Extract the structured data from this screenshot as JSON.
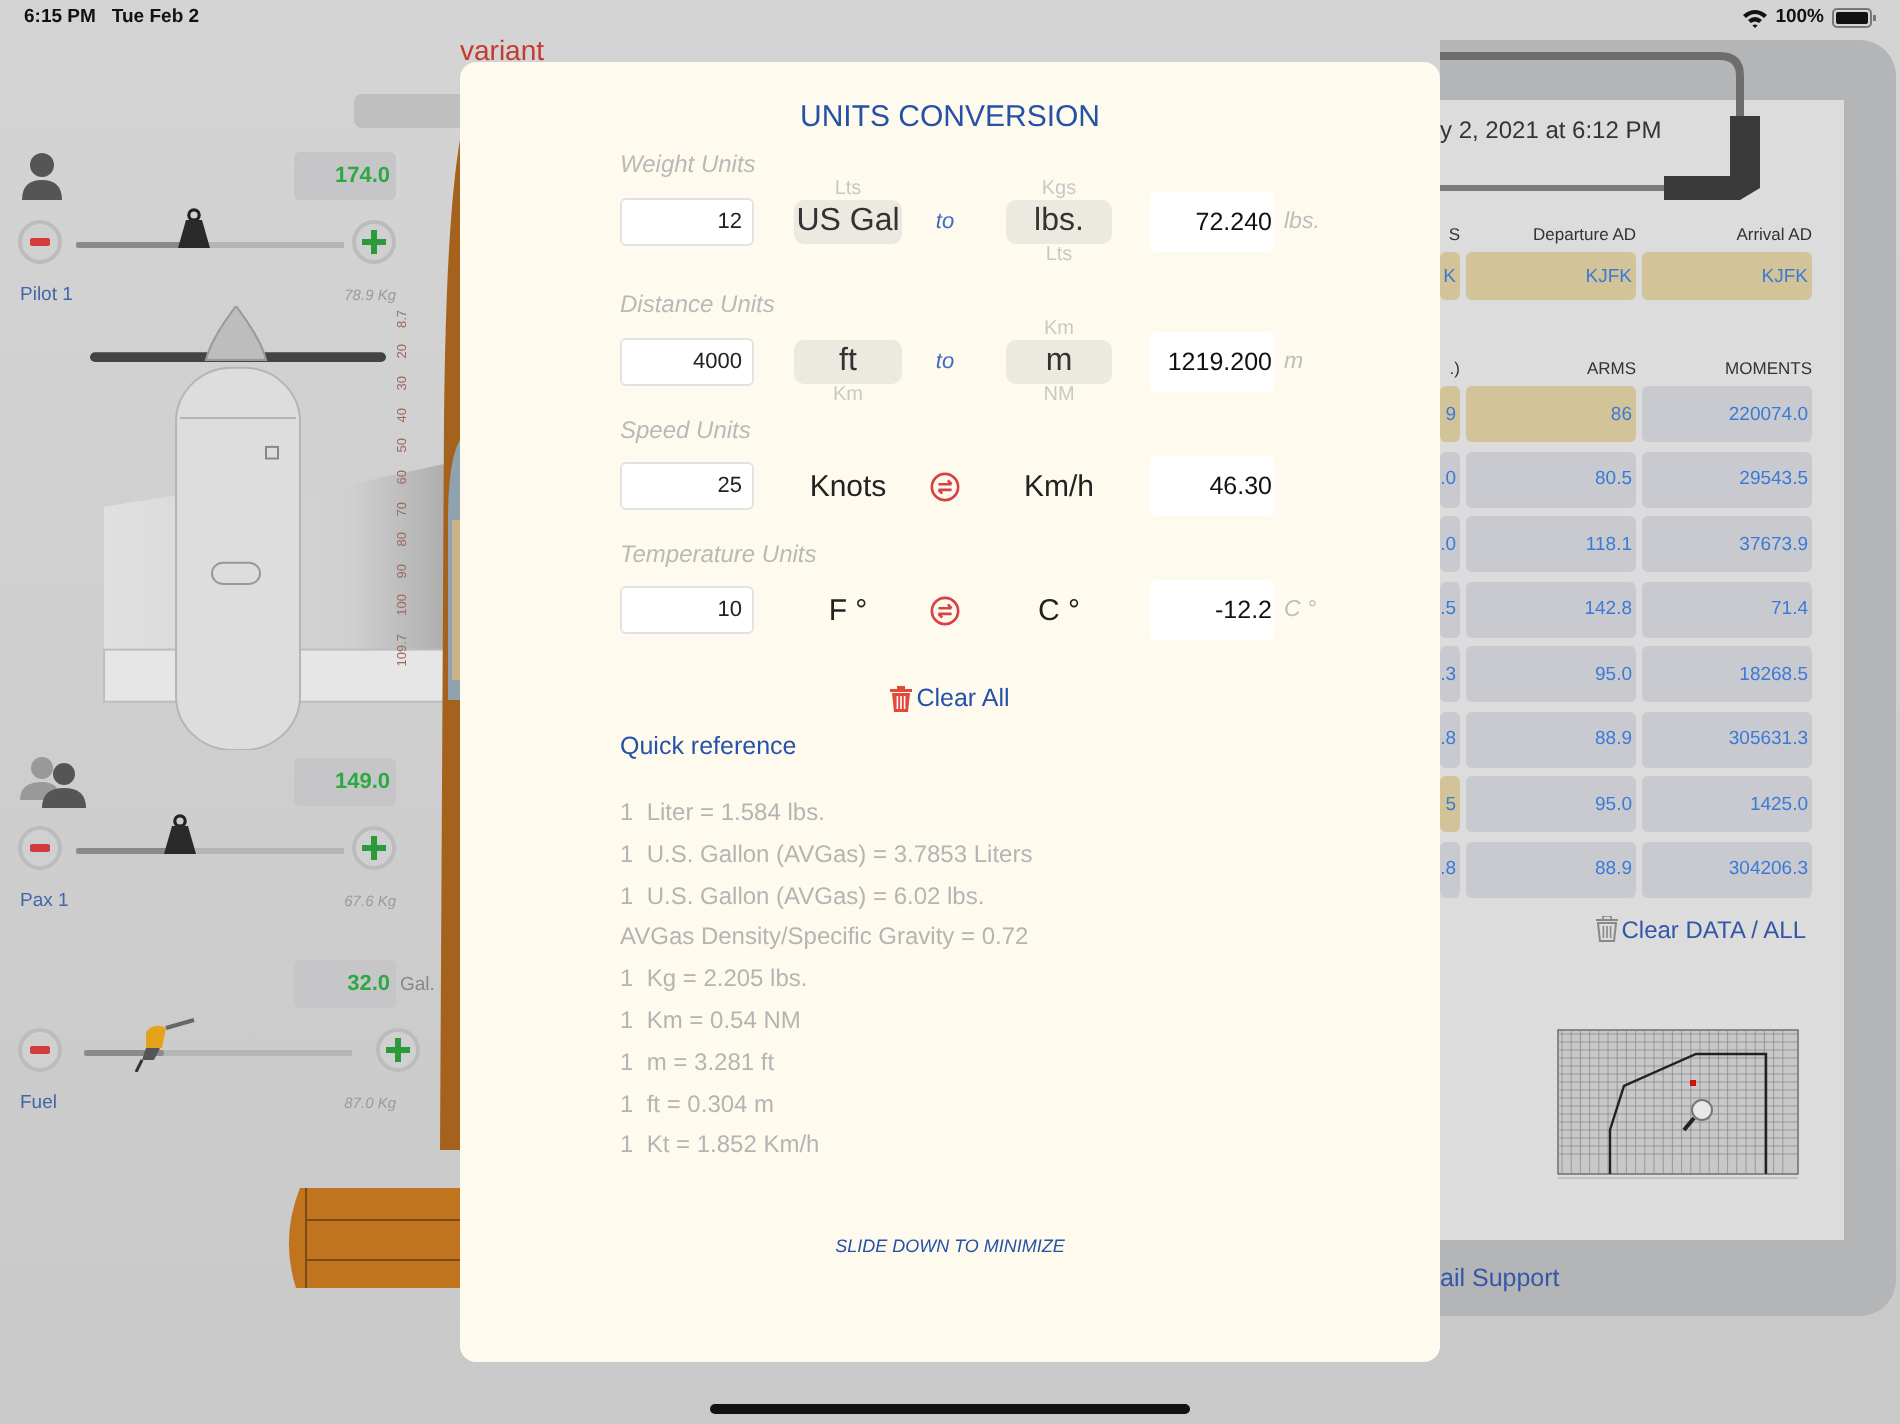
{
  "status_bar": {
    "time": "6:15 PM",
    "date": "Tue Feb 2",
    "battery": "100%"
  },
  "background_title": "variant",
  "loads": [
    {
      "kind": "pilot",
      "label": "Pilot 1",
      "value": "174.0",
      "level": 0.44,
      "mass": "78.9 Kg"
    },
    {
      "kind": "pax",
      "label": "Pax 1",
      "value": "149.0",
      "level": 0.39,
      "mass": "67.6 Kg"
    },
    {
      "kind": "fuel",
      "label": "Fuel",
      "value": "32.0",
      "unit": "Gal.",
      "level": 0.3,
      "mass": "87.0 Kg"
    }
  ],
  "arm_scale": [
    "8.7",
    "20",
    "30",
    "40",
    "50",
    "60",
    "70",
    "80",
    "90",
    "100",
    "109.7"
  ],
  "dialog": {
    "title": "UNITS CONVERSION",
    "sections": [
      {
        "kind": "picker",
        "label": "Weight Units",
        "input": "12",
        "from": {
          "above": "Lts",
          "selected": "US Gal"
        },
        "connector": "to",
        "to": {
          "above": "Kgs",
          "selected": "lbs.",
          "below": "Lts"
        },
        "result": "72.240",
        "unit": "lbs."
      },
      {
        "kind": "picker",
        "label": "Distance Units",
        "input": "4000",
        "from": {
          "selected": "ft",
          "below": "Km"
        },
        "connector": "to",
        "to": {
          "above": "Km",
          "selected": "m",
          "below": "NM"
        },
        "result": "1219.200",
        "unit": "m"
      },
      {
        "kind": "swap",
        "label": "Speed Units",
        "input": "25",
        "from": {
          "selected": "Knots"
        },
        "to": {
          "selected": "Km/h"
        },
        "result": "46.30"
      },
      {
        "kind": "swap",
        "label": "Temperature Units",
        "input": "10",
        "from": {
          "selected": "F °"
        },
        "to": {
          "selected": "C °"
        },
        "result": "-12.2",
        "unit": "C °"
      }
    ],
    "clear_button": "Clear All",
    "reference_title": "Quick reference",
    "reference": [
      "1  Liter = 1.584 lbs.",
      "1  U.S. Gallon (AVGas) = 3.7853 Liters",
      "1  U.S. Gallon (AVGas) = 6.02 lbs.",
      "AVGas Density/Specific Gravity = 0.72",
      "1  Kg = 2.205 lbs.",
      "1  Km = 0.54 NM",
      "1  m = 3.281 ft",
      "1  ft = 0.304 m",
      "1  Kt = 1.852 Km/h"
    ],
    "footer": "SLIDE DOWN TO MINIMIZE"
  },
  "flight_sheet": {
    "date": "y 2, 2021 at 6:12 PM",
    "route_headers": [
      "S",
      "Departure AD",
      "Arrival AD"
    ],
    "route_values": [
      {
        "text": "K",
        "highlighted": true
      },
      {
        "text": "KJFK",
        "highlighted": true
      },
      {
        "text": "KJFK",
        "highlighted": true
      }
    ],
    "table_headers": [
      ".)",
      "ARMS",
      "MOMENTS"
    ],
    "rows": [
      {
        "cells": [
          {
            "text": "9",
            "highlighted": true
          },
          {
            "text": "86",
            "highlighted": true
          },
          {
            "text": "220074.0",
            "highlighted": false
          }
        ]
      },
      {
        "cells": [
          {
            "text": ".0",
            "highlighted": false
          },
          {
            "text": "80.5",
            "highlighted": false
          },
          {
            "text": "29543.5",
            "highlighted": false
          }
        ]
      },
      {
        "cells": [
          {
            "text": ".0",
            "highlighted": false
          },
          {
            "text": "118.1",
            "highlighted": false
          },
          {
            "text": "37673.9",
            "highlighted": false
          }
        ]
      },
      {
        "cells": [
          {
            "text": ".5",
            "highlighted": false
          },
          {
            "text": "142.8",
            "highlighted": false
          },
          {
            "text": "71.4",
            "highlighted": false
          }
        ]
      },
      {
        "cells": [
          {
            "text": ".3",
            "highlighted": false
          },
          {
            "text": "95.0",
            "highlighted": false
          },
          {
            "text": "18268.5",
            "highlighted": false
          }
        ]
      },
      {
        "cells": [
          {
            "text": ".8",
            "highlighted": false
          },
          {
            "text": "88.9",
            "highlighted": false
          },
          {
            "text": "305631.3",
            "highlighted": false
          }
        ]
      },
      {
        "cells": [
          {
            "text": "5",
            "highlighted": true
          },
          {
            "text": "95.0",
            "highlighted": false
          },
          {
            "text": "1425.0",
            "highlighted": false
          }
        ]
      },
      {
        "cells": [
          {
            "text": ".8",
            "highlighted": false
          },
          {
            "text": "88.9",
            "highlighted": false
          },
          {
            "text": "304206.3",
            "highlighted": false
          }
        ]
      }
    ],
    "clear_button": "Clear DATA / ALL",
    "support_link": "ail Support"
  }
}
